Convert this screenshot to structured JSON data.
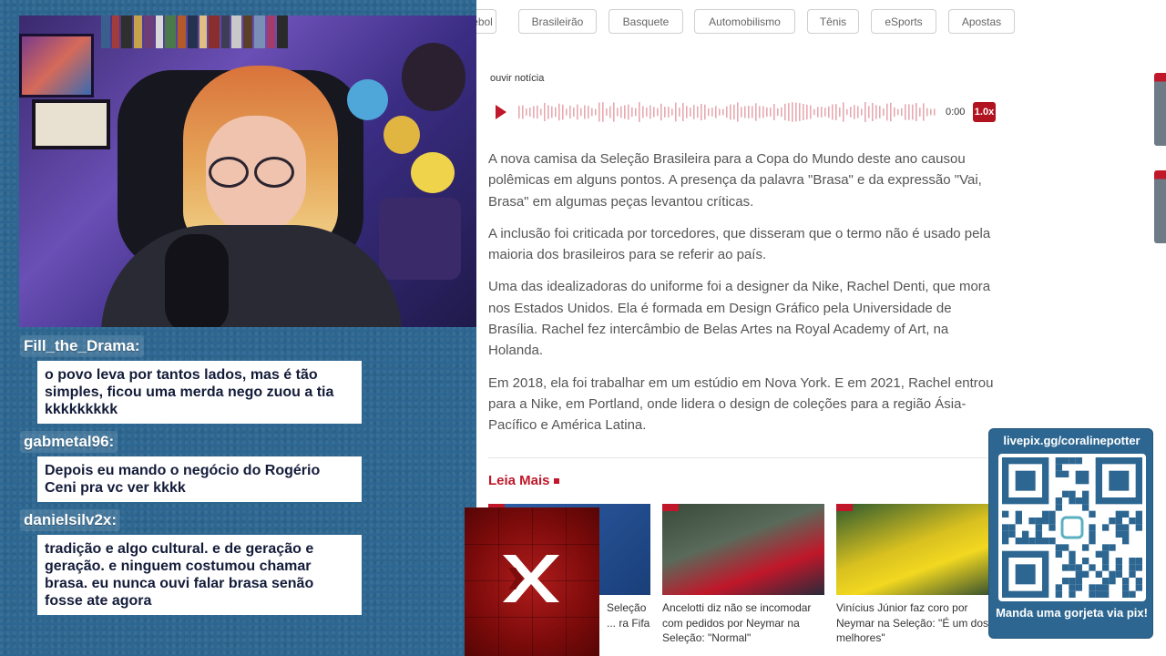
{
  "chat": {
    "messages": [
      {
        "user": "Fill_the_Drama:",
        "text": "o povo leva por tantos lados, mas é tão simples, ficou uma merda nego zuou a tia kkkkkkkkk"
      },
      {
        "user": "gabmetal96:",
        "text": "Depois eu mando o negócio do Rogério Ceni pra vc ver kkkk"
      },
      {
        "user": "danielsilv2x:",
        "text": "tradição e algo cultural. e de geração e geração. e ninguem costumou chamar brasa. eu nunca ouvi falar brasa senão fosse ate agora"
      }
    ]
  },
  "nav": {
    "tabs": [
      "ebol",
      "Brasileirão",
      "Basquete",
      "Automobilismo",
      "Tênis",
      "eSports",
      "Apostas"
    ]
  },
  "audio": {
    "label": "ouvir notícia",
    "time": "0:00",
    "speed": "1.0x"
  },
  "article": {
    "paragraphs": [
      "A nova camisa da Seleção Brasileira para a Copa do Mundo deste ano causou polêmicas em alguns pontos. A presença da palavra \"Brasa\" e da expressão \"Vai, Brasa\" em algumas peças levantou críticas.",
      "A inclusão foi criticada por torcedores, que disseram que o termo não é usado pela maioria dos brasileiros para se referir ao país.",
      "Uma das idealizadoras do uniforme foi a designer da Nike, Rachel Denti, que mora nos Estados Unidos. Ela é formada em Design Gráfico pela Universidade de Brasília. Rachel fez intercâmbio de Belas Artes na Royal Academy of Art, na Holanda.",
      "Em 2018, ela foi trabalhar em um estúdio em Nova York. E em 2021, Rachel entrou para a Nike, em Portland, onde lidera o design de coleções para a região Ásia-Pacífico e América Latina."
    ]
  },
  "related": {
    "heading": "Leia Mais",
    "cards": [
      {
        "title": "Seleção ... ra Fifa"
      },
      {
        "title": "Ancelotti diz não se incomodar com pedidos por Neymar na Seleção: \"Normal\""
      },
      {
        "title": "Vinícius Júnior faz coro por Neymar na Seleção: \"É um dos melhores\""
      }
    ]
  },
  "pix": {
    "url": "livepix.gg/coralinepotter",
    "cta": "Manda uma gorjeta via pix!"
  },
  "colors": {
    "brand_red": "#c0172a",
    "overlay_blue": "#2d6791",
    "chat_text": "#141c3a"
  }
}
